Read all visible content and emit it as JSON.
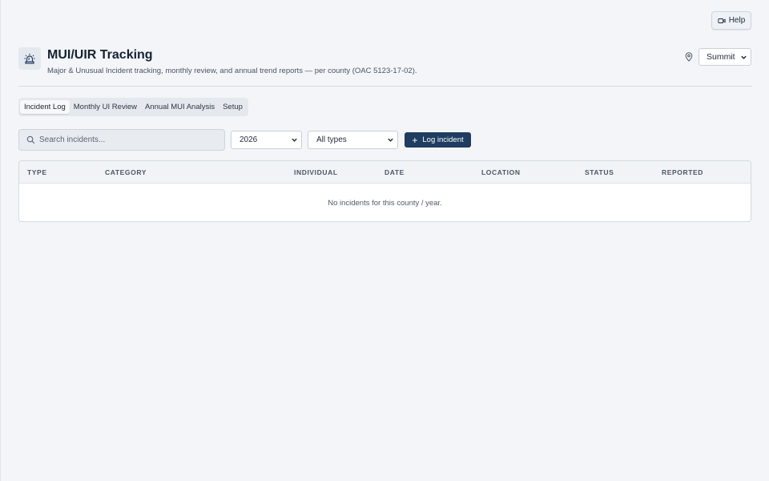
{
  "help": {
    "label": "Help",
    "icon": "video-icon"
  },
  "header": {
    "icon": "siren-icon",
    "title": "MUI/UIR Tracking",
    "subtitle": "Major & Unusual Incident tracking, monthly review, and annual trend reports — per county (OAC 5123-17-02).",
    "county": "Summit"
  },
  "tabs": [
    {
      "label": "Incident Log",
      "active": true
    },
    {
      "label": "Monthly UI Review",
      "active": false
    },
    {
      "label": "Annual MUI Analysis",
      "active": false
    },
    {
      "label": "Setup",
      "active": false
    }
  ],
  "toolbar": {
    "search_placeholder": "Search incidents...",
    "year": "2026",
    "type_filter": "All types",
    "log_label": "Log incident"
  },
  "table": {
    "columns": [
      "TYPE",
      "CATEGORY",
      "INDIVIDUAL",
      "DATE",
      "LOCATION",
      "STATUS",
      "REPORTED"
    ],
    "rows": [],
    "empty_message": "No incidents for this county / year."
  }
}
